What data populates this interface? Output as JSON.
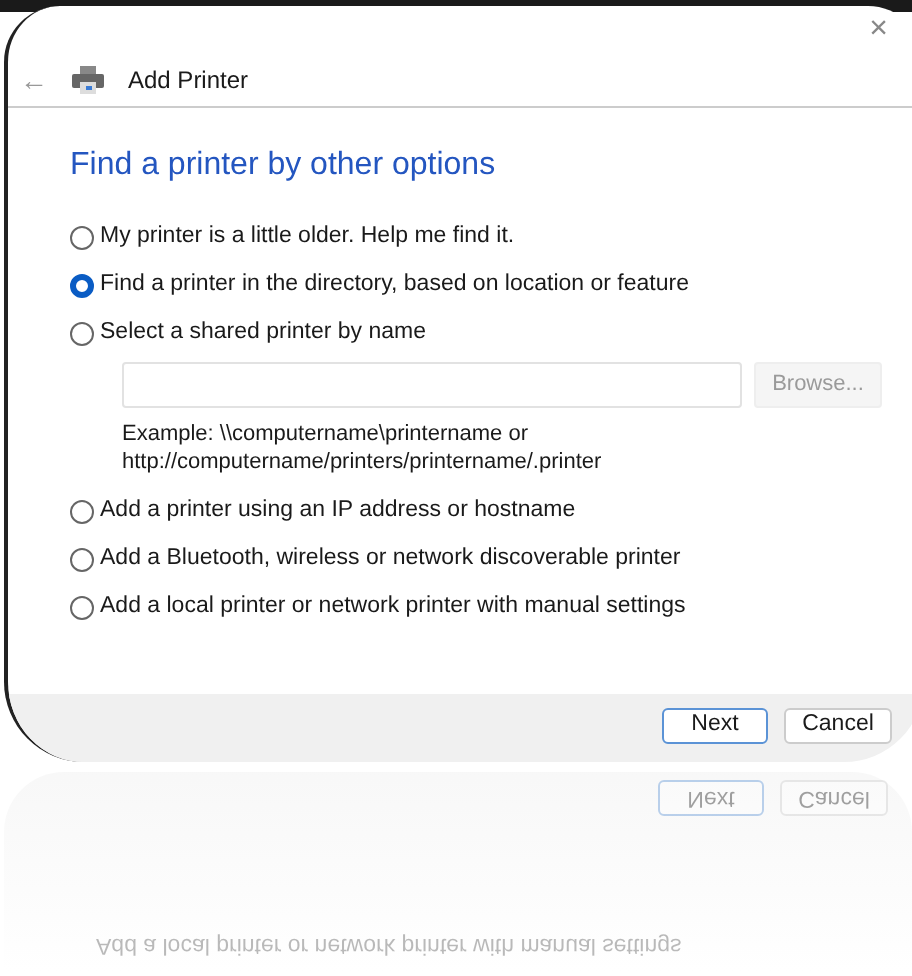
{
  "window": {
    "close": "×",
    "title": "Add Printer",
    "back": "←"
  },
  "heading": "Find a printer by other options",
  "options": [
    {
      "label": "My printer is a little older. Help me find it.",
      "selected": false
    },
    {
      "label": "Find a printer in the directory, based on location or feature",
      "selected": true
    },
    {
      "label": "Select a shared printer by name",
      "selected": false,
      "kind": "with_field"
    },
    {
      "label": "Add a printer using an IP address or hostname",
      "selected": false
    },
    {
      "label": "Add a Bluetooth, wireless or network discoverable printer",
      "selected": false
    },
    {
      "label": "Add a local printer or network printer with manual settings",
      "selected": false
    }
  ],
  "share_field": {
    "browse": "Browse...",
    "browse_disabled": true,
    "example_lines": [
      "Example: \\\\computername\\printername or",
      "http://computername/printers/printername/.printer"
    ]
  },
  "buttons": [
    {
      "label": "Next",
      "default": true
    },
    {
      "label": "Cancel",
      "default": false
    }
  ],
  "reflection": {
    "buttons": [
      "Next",
      "Cancel"
    ],
    "option": "Add a local printer or network printer with manual settings"
  }
}
